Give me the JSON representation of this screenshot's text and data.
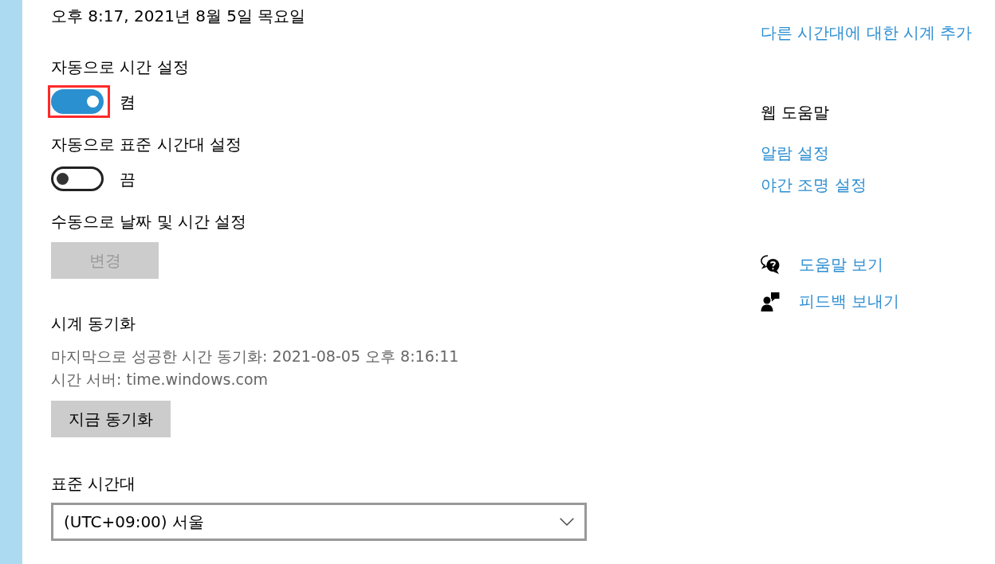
{
  "current_datetime": "오후 8:17, 2021년 8월 5일 목요일",
  "settings": [
    {
      "kind": "toggle",
      "label": "자동으로 시간 설정",
      "on": true,
      "state_text": "켬",
      "highlighted": true
    },
    {
      "kind": "toggle",
      "label": "자동으로 표준 시간대 설정",
      "on": false,
      "state_text": "끔",
      "highlighted": false
    },
    {
      "kind": "button",
      "label": "수동으로 날짜 및 시간 설정",
      "button": "변경",
      "disabled": true
    },
    {
      "kind": "sync",
      "label": "시계 동기화",
      "details": [
        "마지막으로 성공한 시간 동기화: 2021-08-05 오후 8:16:11",
        "시간 서버: time.windows.com"
      ],
      "button": "지금 동기화",
      "disabled": false
    },
    {
      "kind": "dropdown",
      "label": "표준 시간대",
      "value": "(UTC+09:00) 서울"
    }
  ],
  "related": {
    "links": [
      "다른 시간대에 대한 시계 추가"
    ],
    "web_help": {
      "title": "웹 도움말",
      "links": [
        "알람 설정",
        "야간 조명 설정"
      ]
    }
  },
  "support": [
    {
      "kind": "help",
      "label": "도움말 보기"
    },
    {
      "kind": "feedback",
      "label": "피드백 보내기"
    }
  ]
}
